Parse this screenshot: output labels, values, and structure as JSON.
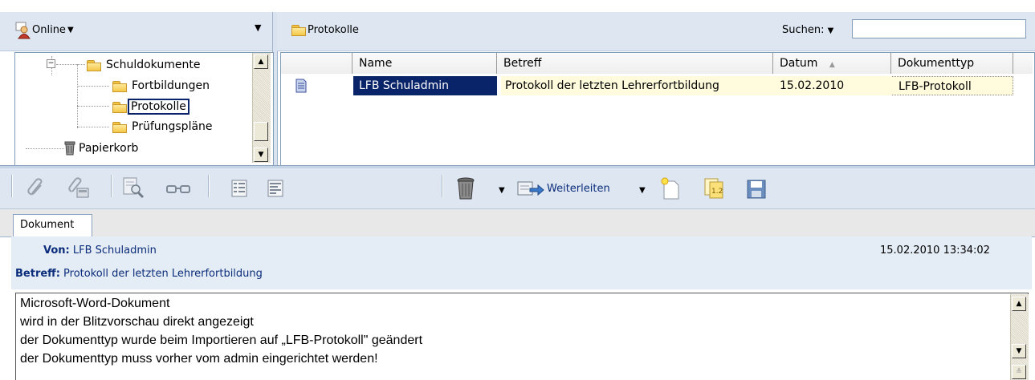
{
  "status": {
    "label": "Online"
  },
  "tree": {
    "items": [
      {
        "label": "Schuldokumente"
      },
      {
        "label": "Fortbildungen"
      },
      {
        "label": "Protokolle"
      },
      {
        "label": "Prüfungspläne"
      },
      {
        "label": "Papierkorb"
      }
    ]
  },
  "folder_header": {
    "title": "Protokolle",
    "search_label": "Suchen:",
    "search_value": ""
  },
  "table": {
    "columns": [
      "Name",
      "Betreff",
      "Datum",
      "Dokumenttyp"
    ],
    "rows": [
      {
        "name": "LFB Schuladmin",
        "betreff": "Protokoll der letzten Lehrerfortbildung",
        "datum": "15.02.2010",
        "typ": "LFB-Protokoll"
      }
    ]
  },
  "toolbar": {
    "forward_label": "Weiterleiten"
  },
  "tabs": [
    {
      "label": "Dokument"
    }
  ],
  "message": {
    "from_label": "Von:",
    "from_value": "LFB Schuladmin",
    "subject_label": "Betreff:",
    "subject_value": "Protokoll der letzten Lehrerfortbildung",
    "timestamp": "15.02.2010 13:34:02",
    "body_lines": [
      "Microsoft-Word-Dokument",
      "wird in der Blitzvorschau direkt angezeigt",
      "der Dokumenttyp wurde beim Importieren auf „LFB-Protokoll\" geändert",
      "der Dokumenttyp muss vorher vom admin eingerichtet werden!"
    ]
  },
  "colors": {
    "selection": "#0a246a",
    "highlight_row": "#fffbdc",
    "header_bg": "#dde6f1",
    "link": "#0b2c7a"
  },
  "icons": [
    "user-status-icon",
    "folder-icon",
    "trash-icon",
    "document-icon",
    "attach-icon",
    "attach-view-icon",
    "preview-icon",
    "glasses-icon",
    "list-icon",
    "list2-icon",
    "trash-tool-icon",
    "forward-icon",
    "new-doc-icon",
    "import-icon",
    "save-icon"
  ]
}
